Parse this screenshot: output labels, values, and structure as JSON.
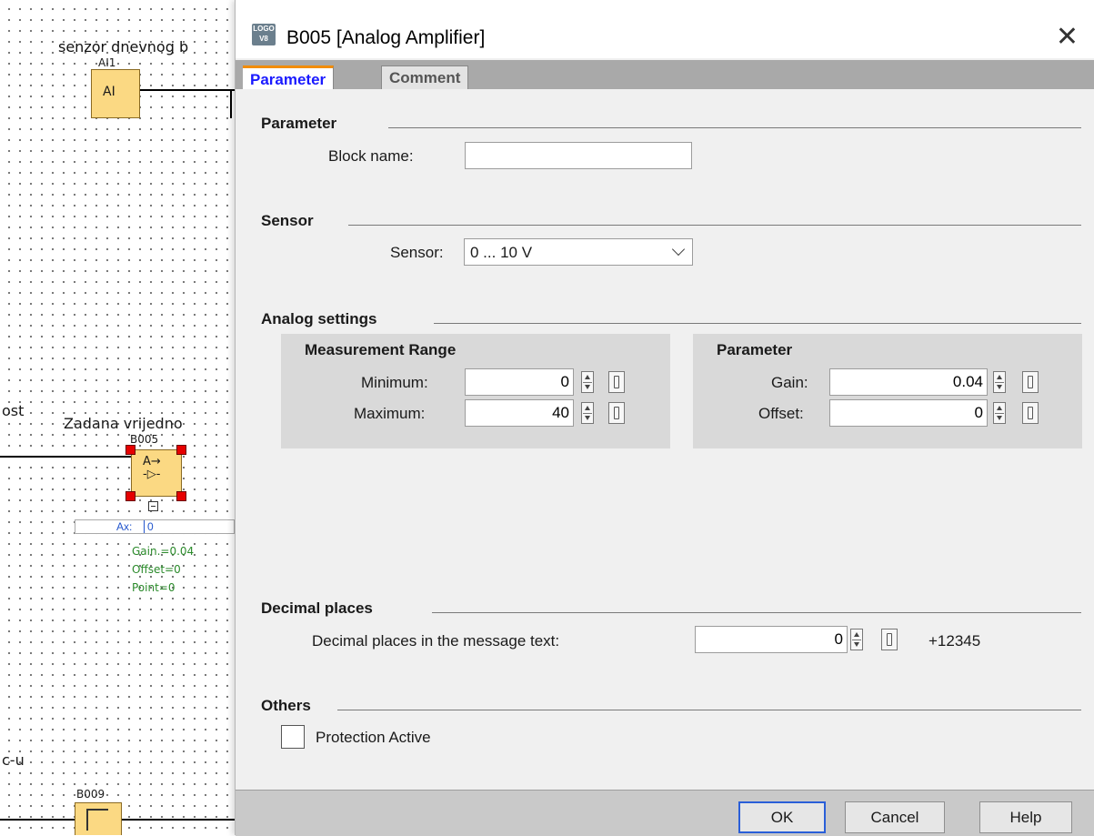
{
  "canvas": {
    "senzor_label": "senzor dnevnog b",
    "ai1_label": "AI1",
    "ai_block": "AI",
    "ost_label": "ost",
    "zadana_label": "Zadana vrijedno",
    "b005_label": "B005",
    "amp_block": "A→\n-▷-",
    "ax_label": "Ax:",
    "ax_value": "0",
    "gain_text": "Gain.=0.04",
    "offset_text": "Offset=0",
    "point_text": "Point=0",
    "cu_label": "c-u",
    "b009_label": "B009",
    "block_color": "#fbd983",
    "handle_color": "#e60000"
  },
  "dialog": {
    "icon_text": "LOGO V8",
    "title": "B005 [Analog Amplifier]",
    "close_glyph": "✕",
    "tabs": [
      {
        "label": "Parameter",
        "active": true
      },
      {
        "label": "Comment",
        "active": false
      }
    ],
    "parameter_section": {
      "title": "Parameter",
      "block_name_label": "Block name:",
      "block_name_value": ""
    },
    "sensor_section": {
      "title": "Sensor",
      "sensor_label": "Sensor:",
      "sensor_value": "0 ... 10 V"
    },
    "analog_section": {
      "title": "Analog settings",
      "measurement_range": {
        "title": "Measurement Range",
        "minimum_label": "Minimum:",
        "minimum_value": "0",
        "maximum_label": "Maximum:",
        "maximum_value": "40"
      },
      "parameter": {
        "title": "Parameter",
        "gain_label": "Gain:",
        "gain_value": "0.04",
        "offset_label": "Offset:",
        "offset_value": "0"
      }
    },
    "decimal_section": {
      "title": "Decimal places",
      "label": "Decimal places in the message text:",
      "value": "0",
      "preview": "+12345"
    },
    "others_section": {
      "title": "Others",
      "protection_label": "Protection Active",
      "protection_checked": false
    },
    "buttons": {
      "ok": "OK",
      "cancel": "Cancel",
      "help": "Help"
    },
    "accent_color": "#f28c00",
    "active_tab_color": "#1a1aff"
  }
}
